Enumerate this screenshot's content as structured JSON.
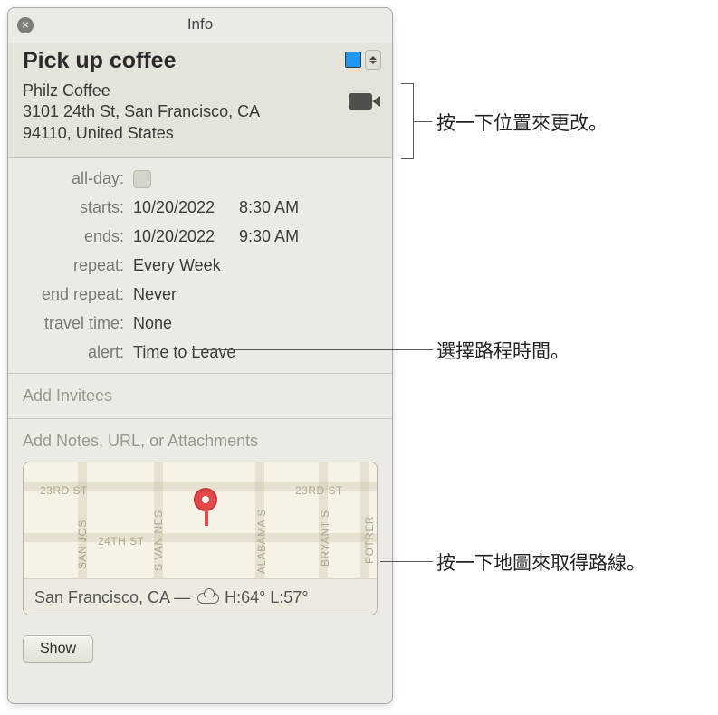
{
  "window": {
    "title": "Info"
  },
  "event": {
    "title": "Pick up coffee",
    "location_name": "Philz Coffee",
    "address_line1": "3101 24th St, San Francisco, CA",
    "address_line2": "94110, United States"
  },
  "details": {
    "allday_label": "all-day:",
    "starts_label": "starts:",
    "starts_date": "10/20/2022",
    "starts_time": "8:30 AM",
    "ends_label": "ends:",
    "ends_date": "10/20/2022",
    "ends_time": "9:30 AM",
    "repeat_label": "repeat:",
    "repeat_value": "Every Week",
    "endrepeat_label": "end repeat:",
    "endrepeat_value": "Never",
    "travel_label": "travel time:",
    "travel_value": "None",
    "alert_label": "alert:",
    "alert_value": "Time to Leave"
  },
  "invitees_placeholder": "Add Invitees",
  "notes_placeholder": "Add Notes, URL, or Attachments",
  "map": {
    "streets": {
      "s1": "23RD ST",
      "s2": "23RD ST",
      "s3": "24TH ST",
      "s4": "SAN JOS",
      "s5": "S VAN NES",
      "s6": "ALABAMA S",
      "s7": "BRYANT S",
      "s8": "POTRER"
    },
    "weather_city": "San Francisco, CA —",
    "weather_text": "H:64° L:57°"
  },
  "footer": {
    "show_label": "Show"
  },
  "callouts": {
    "c1": "按一下位置來更改。",
    "c2": "選擇路程時間。",
    "c3": "按一下地圖來取得路線。"
  }
}
